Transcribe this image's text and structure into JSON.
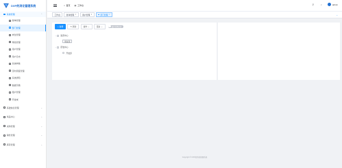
{
  "app": {
    "title": "DXP的消化管理系统",
    "brand_color": "#1f6fd1",
    "accent_color": "#1890ff"
  },
  "sidebar": {
    "group": {
      "label": "系统管理",
      "icon": "settings-icon"
    },
    "items": [
      {
        "label": "账单管理",
        "icon": "user-icon"
      },
      {
        "label": "部门管理",
        "icon": "tree-icon",
        "active": true
      },
      {
        "label": "岗位管理",
        "icon": "post-icon"
      },
      {
        "label": "角色管理",
        "icon": "role-icon"
      },
      {
        "label": "用户管理",
        "icon": "users-icon"
      },
      {
        "label": "用户日志",
        "icon": "log-icon"
      },
      {
        "label": "系统参数",
        "icon": "params-icon"
      },
      {
        "label": "定时调度管理",
        "icon": "clock-icon"
      },
      {
        "label": "系统通知",
        "icon": "bell-icon"
      },
      {
        "label": "数据字典",
        "icon": "dict-icon"
      },
      {
        "label": "租户管理",
        "icon": "tenant-icon"
      },
      {
        "label": "开发域",
        "icon": "code-icon"
      }
    ],
    "bottom_groups": [
      {
        "label": "基础信息管理",
        "icon": "info-icon"
      },
      {
        "label": "商品中心",
        "icon": "goods-icon"
      },
      {
        "label": "采购管理",
        "icon": "cart-icon"
      },
      {
        "label": "销售管理",
        "icon": "sale-icon"
      },
      {
        "label": "库存管理",
        "icon": "stock-icon"
      }
    ]
  },
  "header": {
    "breadcrumbs": [
      {
        "label": "首页",
        "icon": "home-icon"
      },
      {
        "label": "工作台",
        "icon": "workbench-icon"
      }
    ],
    "user_initial": "",
    "username": "admin"
  },
  "tabs": {
    "items": [
      {
        "label": "工作台",
        "closable": false,
        "active": false
      },
      {
        "label": "账单管理",
        "closable": true,
        "active": false
      },
      {
        "label": "用户管理",
        "closable": true,
        "active": false
      },
      {
        "label": "部门管理",
        "closable": true,
        "active": true
      }
    ],
    "close_glyph": "×"
  },
  "toolbar": {
    "add_label": "新增",
    "refresh_label": "刷新",
    "ops_label": "操作",
    "more_label": "更多",
    "switch_label": "展开/折叠全部"
  },
  "tree": {
    "nodes": [
      {
        "label": "集团中心",
        "level": 1,
        "expanded": true
      },
      {
        "label": "测试部",
        "level": 2
      },
      {
        "label": "研发中心",
        "level": 1,
        "expanded": true
      },
      {
        "label": "开发部",
        "level": 2
      }
    ]
  },
  "footer": {
    "copyright": "Copyright © DXP的消化管理系统"
  }
}
